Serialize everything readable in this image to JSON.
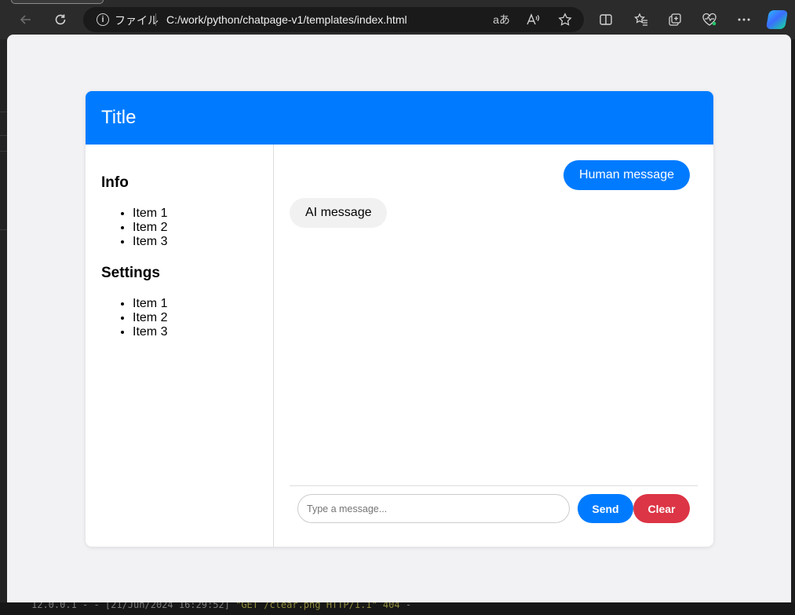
{
  "browser": {
    "address_label": "ファイル",
    "url": "C:/work/python/chatpage-v1/templates/index.html",
    "icons": [
      "back-arrow-icon",
      "refresh-icon",
      "info-icon",
      "read-aloud-icon",
      "favorite-star-icon",
      "split-screen-icon",
      "favorites-icon",
      "collections-icon",
      "health-icon",
      "more-icon",
      "copilot-icon"
    ],
    "read_aloud_glyph": "aあ"
  },
  "card": {
    "title": "Title",
    "header_color": "#007bff"
  },
  "sidebar": {
    "sections": [
      {
        "heading": "Info",
        "items": [
          "Item 1",
          "Item 2",
          "Item 3"
        ]
      },
      {
        "heading": "Settings",
        "items": [
          "Item 1",
          "Item 2",
          "Item 3"
        ]
      }
    ]
  },
  "chat": {
    "messages": [
      {
        "role": "human",
        "text": "Human message"
      },
      {
        "role": "ai",
        "text": "AI message"
      }
    ],
    "input": {
      "placeholder": "Type a message...",
      "value": ""
    },
    "send_label": "Send",
    "clear_label": "Clear",
    "send_color": "#007bff",
    "clear_color": "#dc3545"
  },
  "terminal": {
    "line_time": "12.0.0.1",
    "line_rest": " - - [21/Jun/2024 16:29:52] ",
    "line_req": "\"GET /clear.png HTTP/1.1\" 404",
    "line_dash": " -"
  }
}
